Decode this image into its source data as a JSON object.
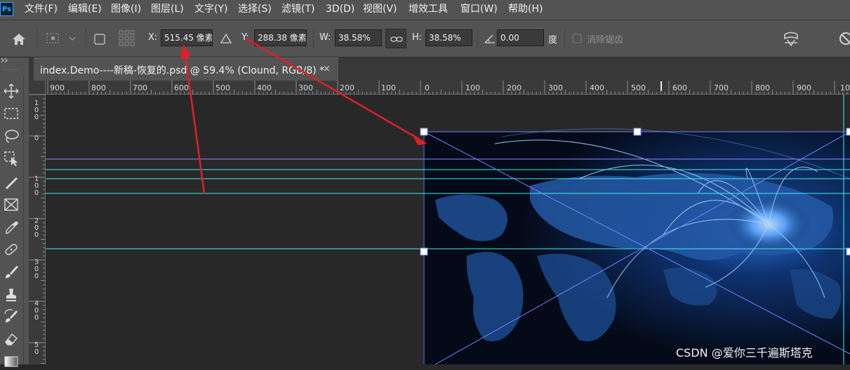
{
  "app": {
    "logo": "Ps"
  },
  "menu": [
    "文件(F)",
    "编辑(E)",
    "图像(I)",
    "图层(L)",
    "文字(Y)",
    "选择(S)",
    "滤镜(T)",
    "3D(D)",
    "视图(V)",
    "增效工具",
    "窗口(W)",
    "帮助(H)"
  ],
  "options": {
    "x_label": "X:",
    "x_value": "515.45 像素",
    "y_label": "Y:",
    "y_value": "288.38 像素",
    "w_label": "W:",
    "w_value": "38.58%",
    "h_label": "H:",
    "h_value": "38.58%",
    "angle_value": "0.00",
    "angle_unit": "度",
    "antialias_label": "消除锯齿"
  },
  "document": {
    "tab_title": "index.Demo----新稿-恢复的.psd @ 59.4% (Clound, RGB/8) *",
    "close": "×"
  },
  "ruler_top": [
    "900",
    "800",
    "700",
    "600",
    "500",
    "400",
    "300",
    "200",
    "100",
    "0",
    "100",
    "200",
    "300",
    "400",
    "500",
    "600",
    "700",
    "800",
    "900",
    "10"
  ],
  "ruler_left": [
    "1 0 0",
    "0",
    "1 0 0",
    "2 0 0",
    "3 0 0",
    "4 0 0",
    "5 0"
  ],
  "watermark": "CSDN @爱你三千遍斯塔克",
  "colors": {
    "guide": "#3ff0f0",
    "selection_guide": "#8a8cff",
    "bounding_box": "#6f84ff",
    "arrow": "#e01f26",
    "menubar": "#535353",
    "canvas": "#282828"
  }
}
